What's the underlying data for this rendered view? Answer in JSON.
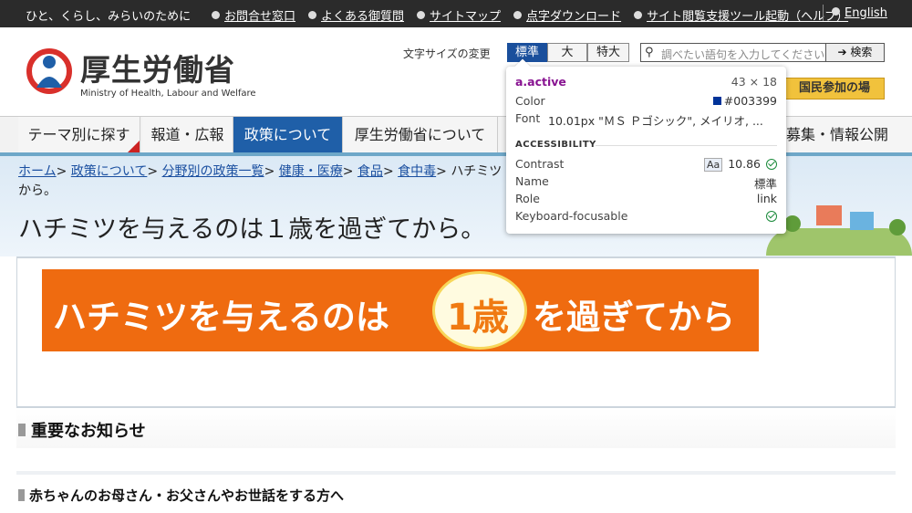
{
  "topbar": {
    "tagline": "ひと、くらし、みらいのために",
    "links": [
      "お問合せ窓口",
      "よくある御質問",
      "サイトマップ",
      "点字ダウンロード",
      "サイト閲覧支援ツール起動（ヘルプ）"
    ],
    "english": "English"
  },
  "header": {
    "logo_title": "厚生労働省",
    "logo_sub": "Ministry of Health, Labour and Welfare",
    "font_size_label": "文字サイズの変更",
    "font_sizes": [
      "標準",
      "大",
      "特大"
    ],
    "search_placeholder": "調べたい語句を入力してください",
    "search_button": "検索",
    "civic_button": "国民参加の場"
  },
  "nav": {
    "items": [
      "テーマ別に探す",
      "報道・広報",
      "政策について",
      "厚生労働省について"
    ],
    "right_item": "募集・情報公開"
  },
  "breadcrumb": {
    "links": [
      "ホーム",
      "政策について",
      "分野別の政策一覧",
      "健康・医療",
      "食品",
      "食中毒"
    ],
    "current_part1": "ハチミツ",
    "current_part2": "から。"
  },
  "page": {
    "title": "ハチミツを与えるのは１歳を過ぎてから。",
    "banner_part1": "ハチミツを与えるのは",
    "banner_age": "1歳",
    "banner_part2": "を過ぎてから",
    "notice_heading": "重要なお知らせ",
    "sub_heading": "赤ちゃんのお母さん・お父さんやお世話をする方へ"
  },
  "tooltip": {
    "selector": "a.active",
    "dimensions": "43 × 18",
    "color_label": "Color",
    "color_value": "#003399",
    "font_label": "Font",
    "font_value": "10.01px \"ＭＳ Ｐゴシック\", メイリオ, ...",
    "section": "ACCESSIBILITY",
    "contrast_label": "Contrast",
    "contrast_badge": "Aa",
    "contrast_value": "10.86",
    "name_label": "Name",
    "name_value": "標準",
    "role_label": "Role",
    "role_value": "link",
    "kb_label": "Keyboard-focusable"
  },
  "colors": {
    "nav_active": "#1f5fa8",
    "banner": "#ef6b10",
    "link": "#003399"
  }
}
